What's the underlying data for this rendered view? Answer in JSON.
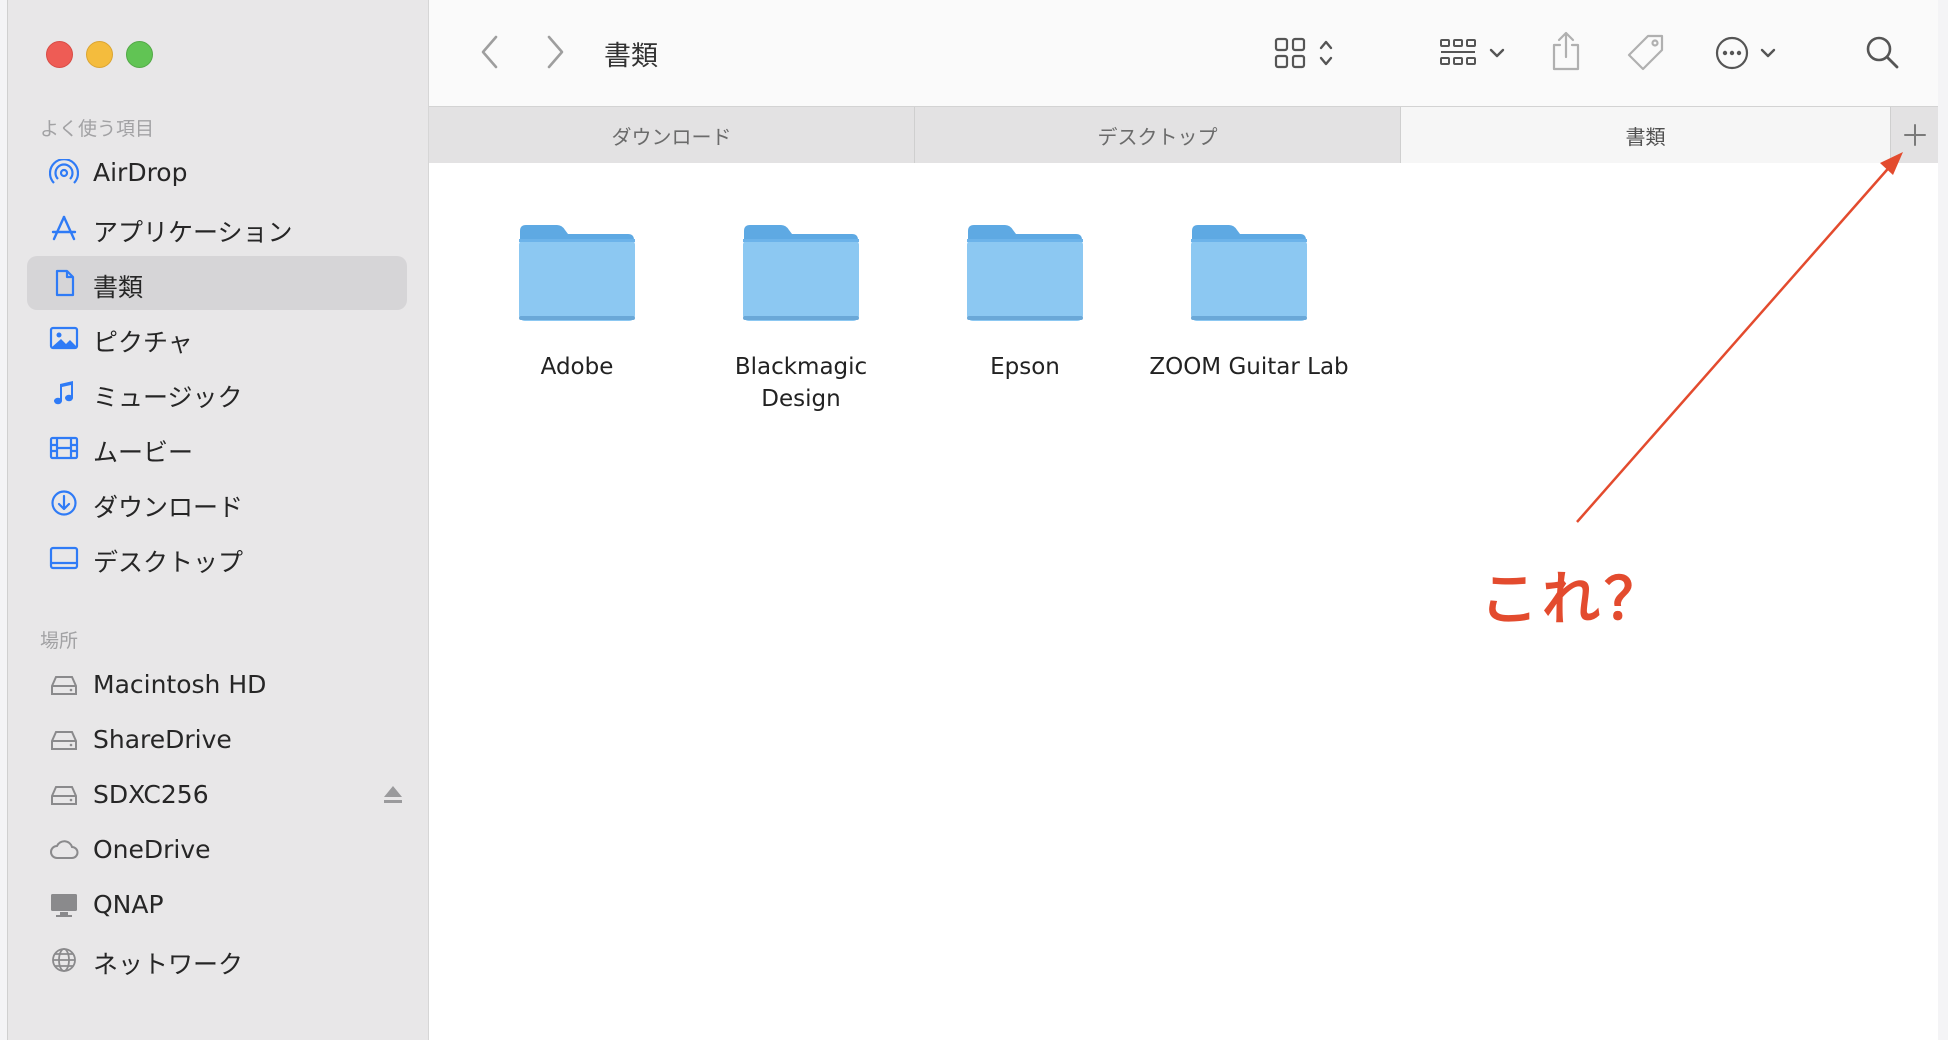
{
  "window": {
    "title": "書類"
  },
  "sidebar": {
    "favorites_header": "よく使う項目",
    "favorites": [
      {
        "label": "AirDrop",
        "icon": "airdrop-icon"
      },
      {
        "label": "アプリケーション",
        "icon": "applications-icon"
      },
      {
        "label": "書類",
        "icon": "document-icon",
        "selected": true
      },
      {
        "label": "ピクチャ",
        "icon": "pictures-icon"
      },
      {
        "label": "ミュージック",
        "icon": "music-note-icon"
      },
      {
        "label": "ムービー",
        "icon": "film-icon"
      },
      {
        "label": "ダウンロード",
        "icon": "download-icon"
      },
      {
        "label": "デスクトップ",
        "icon": "desktop-icon"
      }
    ],
    "locations_header": "場所",
    "locations": [
      {
        "label": "Macintosh HD",
        "icon": "drive-icon"
      },
      {
        "label": "ShareDrive",
        "icon": "drive-icon"
      },
      {
        "label": "SDXC256",
        "icon": "drive-icon",
        "eject": true
      },
      {
        "label": "OneDrive",
        "icon": "cloud-icon"
      },
      {
        "label": "QNAP",
        "icon": "monitor-icon"
      },
      {
        "label": "ネットワーク",
        "icon": "globe-icon"
      }
    ]
  },
  "tabs": [
    {
      "label": "ダウンロード",
      "active": false
    },
    {
      "label": "デスクトップ",
      "active": false
    },
    {
      "label": "書類",
      "active": true
    }
  ],
  "folders": [
    {
      "name": "Adobe"
    },
    {
      "name": "Blackmagic Design"
    },
    {
      "name": "Epson"
    },
    {
      "name": "ZOOM Guitar Lab"
    }
  ],
  "annotation": {
    "text": "これ？",
    "color": "#e34b2e"
  },
  "colors": {
    "accent": "#2f7bf6",
    "folder": "#8cc8f2",
    "folder_dark": "#5ea9e3"
  }
}
